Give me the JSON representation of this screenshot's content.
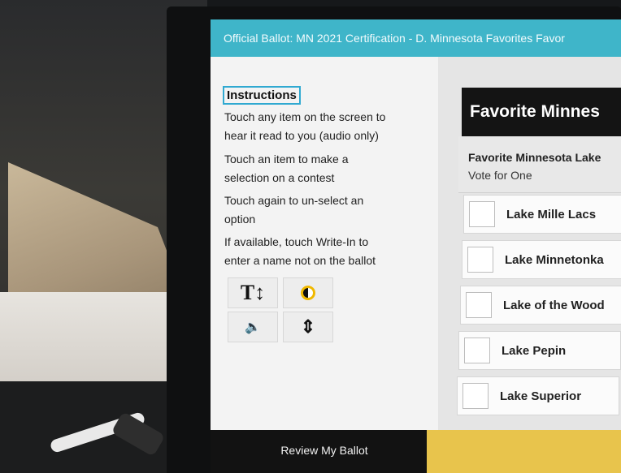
{
  "title_bar": {
    "text": "Official Ballot: MN 2021 Certification - D. Minnesota Favorites Favor"
  },
  "instructions": {
    "heading": "Instructions",
    "lines": [
      "Touch any item on the screen to",
      "hear it read to you (audio only)",
      "Touch an item to make a",
      "selection on a contest",
      "Touch again to un-select an",
      "option",
      "If available, touch Write-In to",
      "enter a name not on the ballot"
    ]
  },
  "tools": {
    "text_size_glyph": "T↕",
    "text_size_icon": "text-size-icon",
    "contrast_icon": "contrast-icon",
    "audio_glyph": "🔈",
    "audio_icon": "speaker-icon",
    "nav_glyph": "⇕",
    "nav_icon": "scroll-up-down-icon",
    "accent": "#f0b800"
  },
  "contest": {
    "header": "Favorite Minnes",
    "title": "Favorite Minnesota Lake",
    "vote_instruction": "Vote for One",
    "options": [
      {
        "label": "Lake Mille Lacs"
      },
      {
        "label": "Lake Minnetonka"
      },
      {
        "label": "Lake of the Wood"
      },
      {
        "label": "Lake Pepin"
      },
      {
        "label": "Lake Superior"
      }
    ]
  },
  "footer": {
    "review_label": "Review My Ballot"
  },
  "colors": {
    "title_bar": "#3fb5c9",
    "header_bg": "#141414",
    "next_button": "#e8c44c",
    "focus_outline": "#30a9d1"
  }
}
